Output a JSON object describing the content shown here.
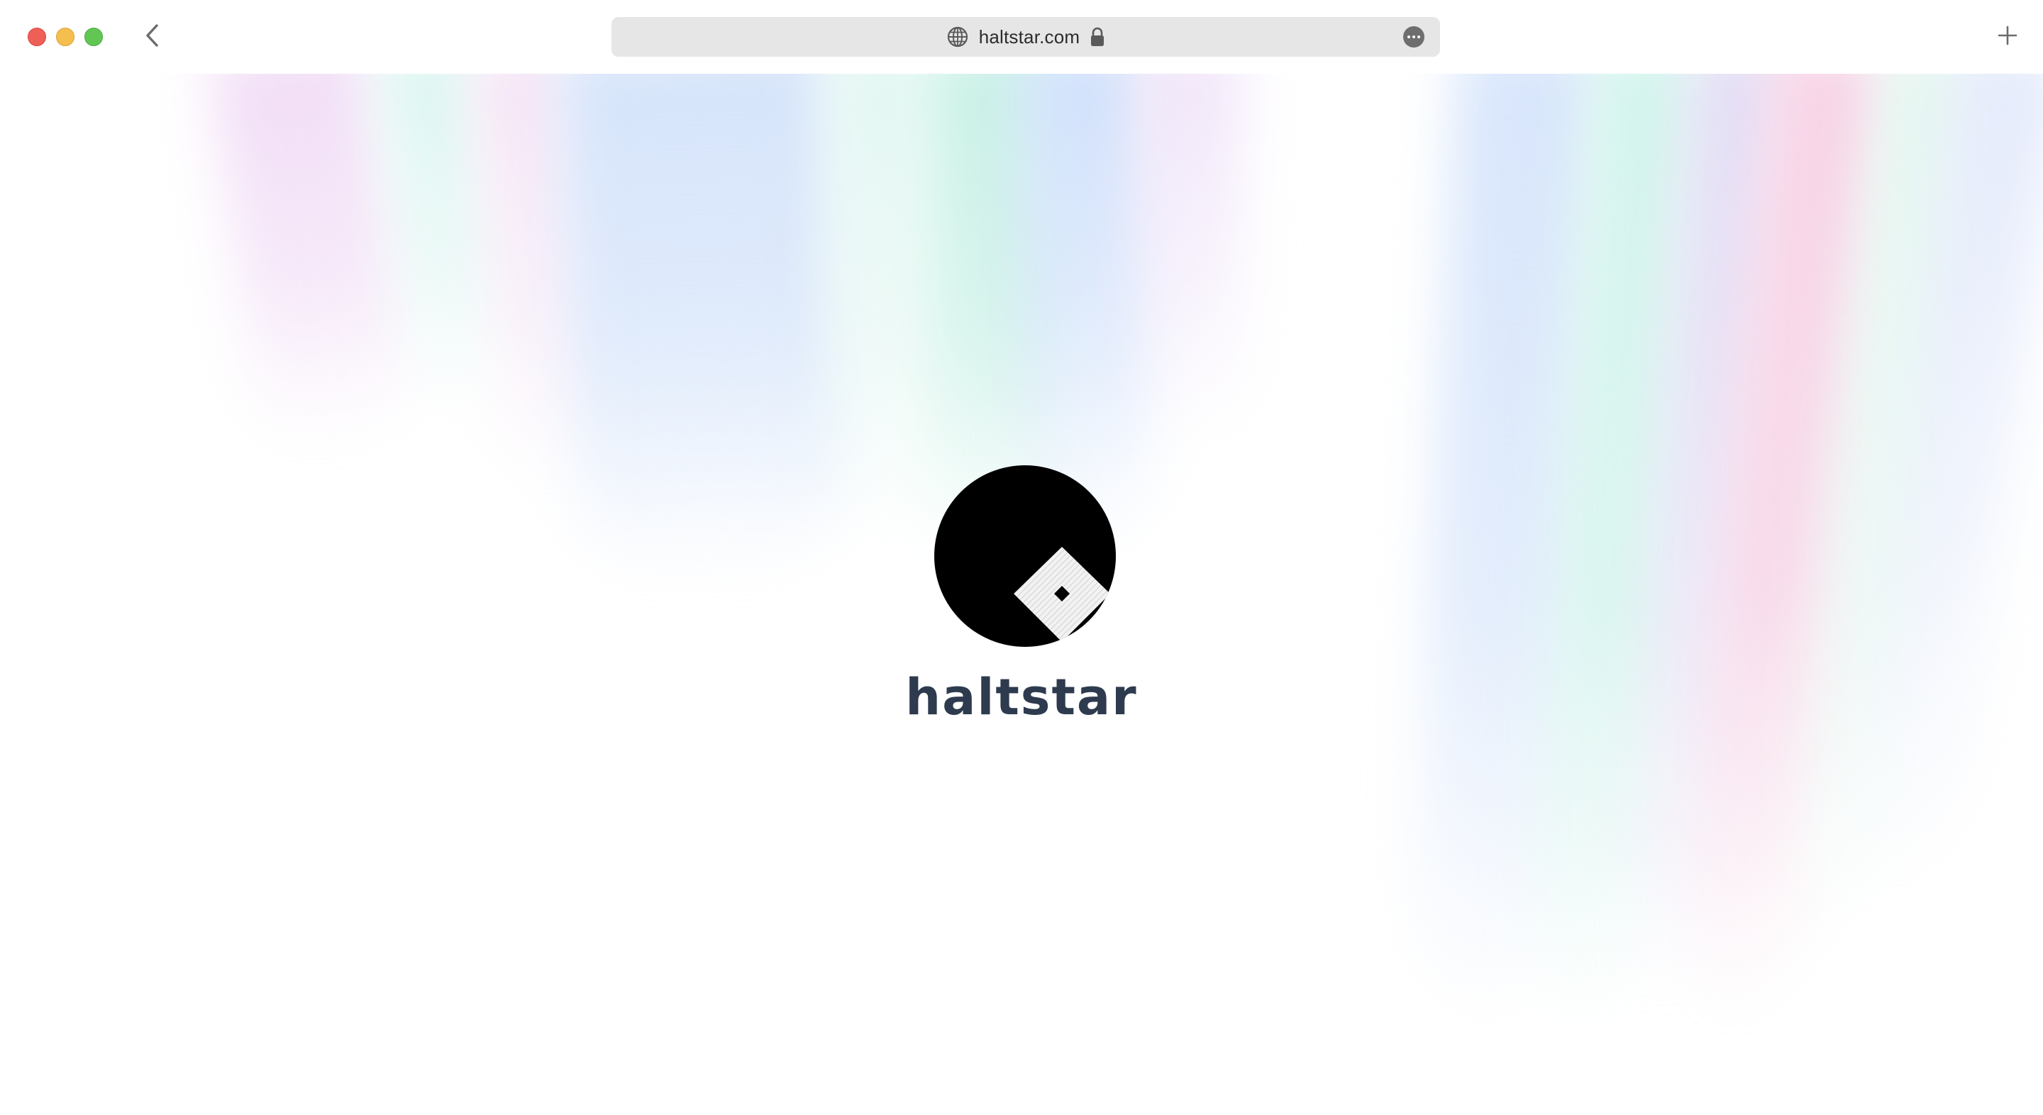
{
  "browser": {
    "url": "haltstar.com",
    "secure": true
  },
  "page": {
    "brand_name": "haltstar",
    "logo": "haltstar-logo"
  },
  "colors": {
    "brand_text": "#2e3b4e",
    "logo_circle": "#000000",
    "aurora_blue": "#cfe0fb",
    "aurora_teal": "#c9f1e6",
    "aurora_pink": "#f7d3e6",
    "aurora_violet": "#ecdcf8"
  },
  "icons": {
    "back": "chevron-left-icon",
    "site": "globe-icon",
    "lock": "lock-icon",
    "more": "ellipsis-circle-icon",
    "new_tab": "plus-icon"
  }
}
